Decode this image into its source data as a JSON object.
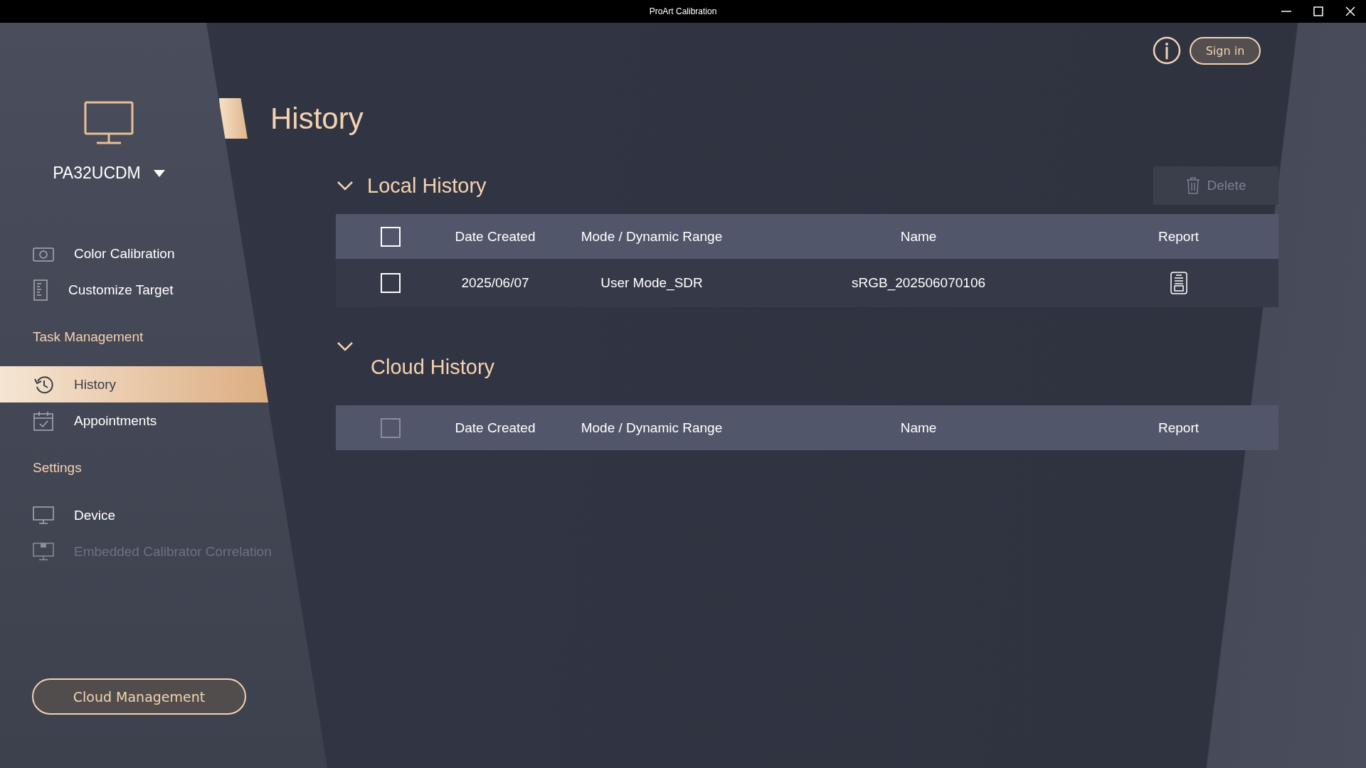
{
  "window": {
    "title": "ProArt Calibration"
  },
  "sidebar": {
    "device": {
      "name": "PA32UCDM"
    },
    "items": [
      {
        "kind": "item",
        "label": "Color Calibration",
        "selected": false,
        "disabled": false
      },
      {
        "kind": "item",
        "label": "Customize Target",
        "selected": false,
        "disabled": false
      },
      {
        "kind": "section",
        "label": "Task Management"
      },
      {
        "kind": "item",
        "label": "History",
        "selected": true,
        "disabled": false
      },
      {
        "kind": "item",
        "label": "Appointments",
        "selected": false,
        "disabled": false
      },
      {
        "kind": "section",
        "label": "Settings"
      },
      {
        "kind": "item",
        "label": "Device",
        "selected": false,
        "disabled": false
      },
      {
        "kind": "item",
        "label": "Embedded Calibrator Correlation",
        "selected": false,
        "disabled": true
      }
    ],
    "footer_button": "Cloud Management"
  },
  "header": {
    "title": "History",
    "sign_in": "Sign in"
  },
  "sections": [
    {
      "title": "Local History",
      "expanded": true,
      "action": {
        "label": "Delete",
        "disabled": true
      },
      "header_checkbox": {
        "checked": false,
        "disabled": false
      },
      "columns": [
        "Date Created",
        "Mode / Dynamic Range",
        "Name",
        "Report"
      ],
      "rows": [
        {
          "checked": false,
          "cells": [
            "2025/06/07",
            "User Mode_SDR",
            "sRGB_202506070106"
          ]
        }
      ]
    },
    {
      "title": "Cloud History",
      "expanded": true,
      "header_checkbox": {
        "checked": false,
        "disabled": true
      },
      "columns": [
        "Date Created",
        "Mode / Dynamic Range",
        "Name",
        "Report"
      ]
    }
  ]
}
